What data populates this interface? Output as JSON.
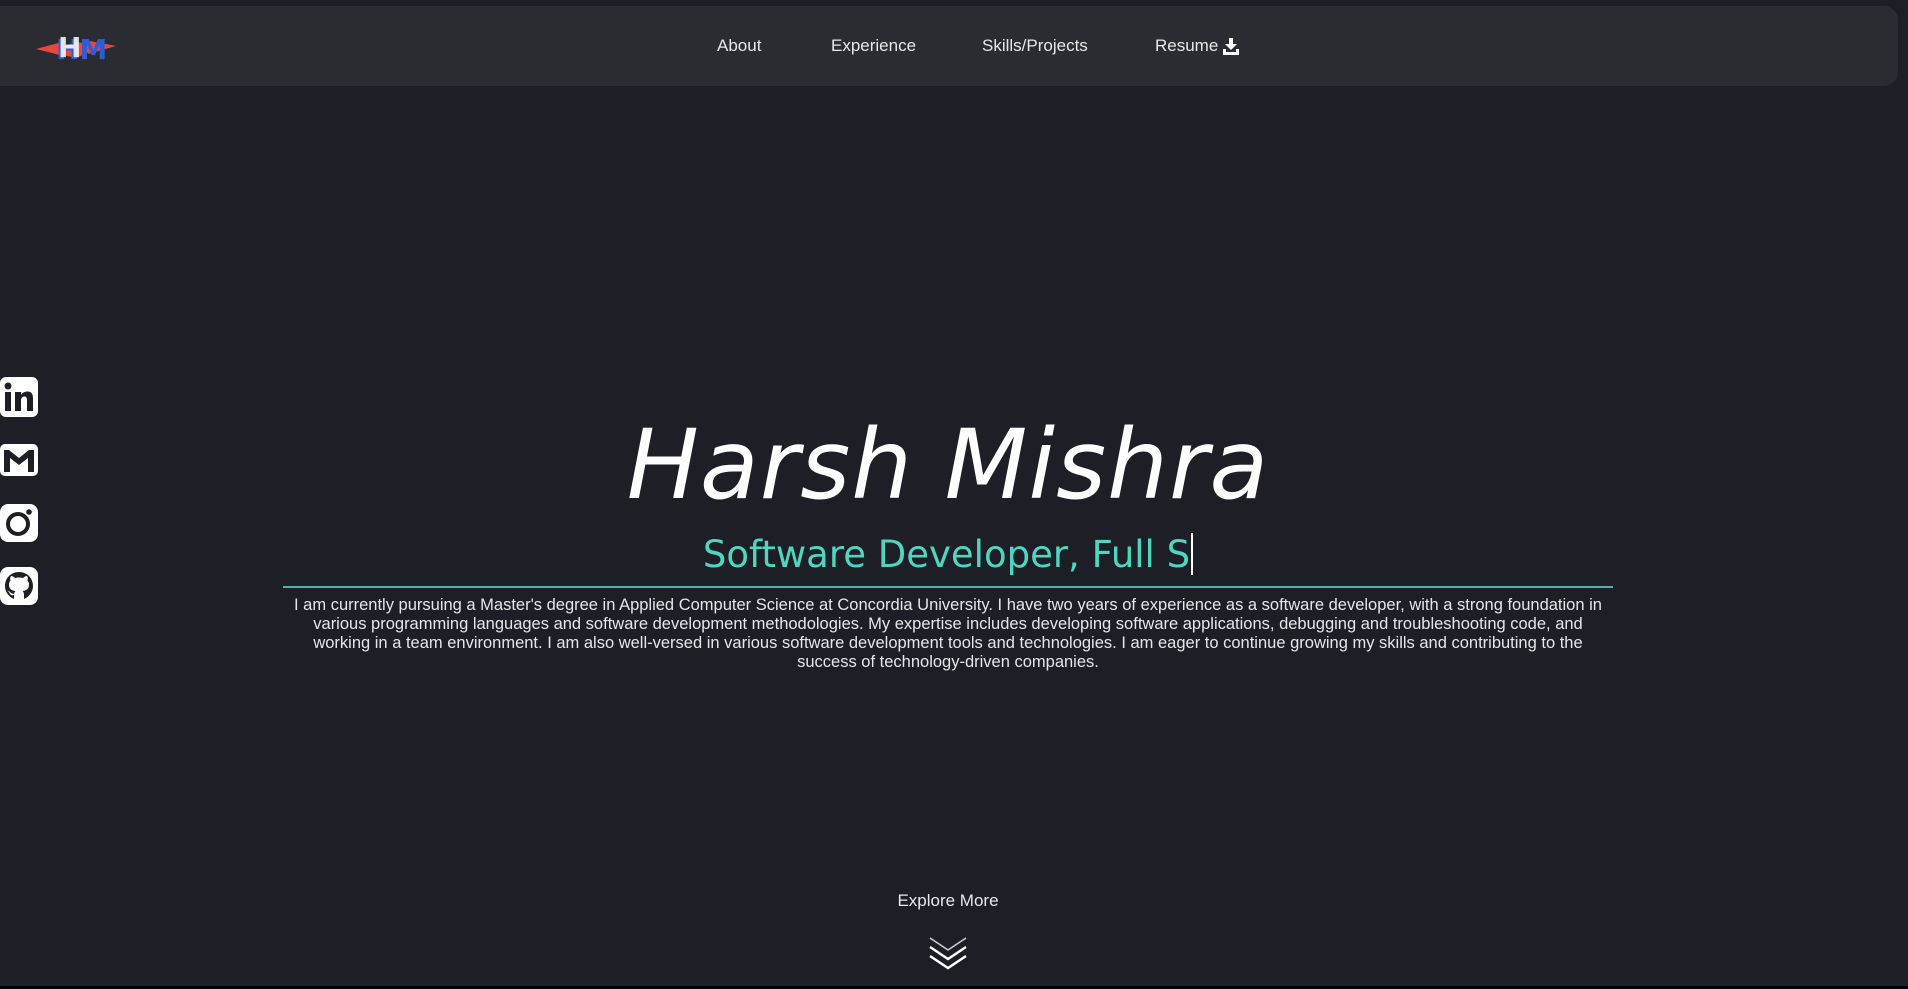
{
  "brand": {
    "logo_text": "HM",
    "colors": {
      "red": "#e8473b",
      "blue": "#2e5bd6",
      "white": "#ffffff"
    }
  },
  "nav": {
    "items": [
      {
        "label": "About"
      },
      {
        "label": "Experience"
      },
      {
        "label": "Skills/Projects"
      },
      {
        "label": "Resume",
        "icon": "download-icon"
      }
    ]
  },
  "social": [
    {
      "name": "LinkedIn",
      "icon": "linkedin-icon"
    },
    {
      "name": "Gmail",
      "icon": "gmail-icon"
    },
    {
      "name": "Instagram",
      "icon": "instagram-icon"
    },
    {
      "name": "GitHub",
      "icon": "github-icon"
    }
  ],
  "hero": {
    "name": "Harsh Mishra",
    "role_typed": "Software Developer, Full S",
    "bio": "I am currently pursuing a Master's degree in Applied Computer Science at Concordia University. I have two years of experience as a software developer, with a strong foundation in various programming languages and software development methodologies. My expertise includes developing software applications, debugging and troubleshooting code, and working in a team environment. I am also well-versed in various software development tools and technologies. I am eager to continue growing my skills and contributing to the success of technology-driven companies."
  },
  "explore": {
    "label": "Explore More",
    "icon": "double-chevron-down-icon"
  },
  "theme": {
    "background": "#1e1f26",
    "navbar": "#2b2c31",
    "accent": "#4fd6c1"
  }
}
